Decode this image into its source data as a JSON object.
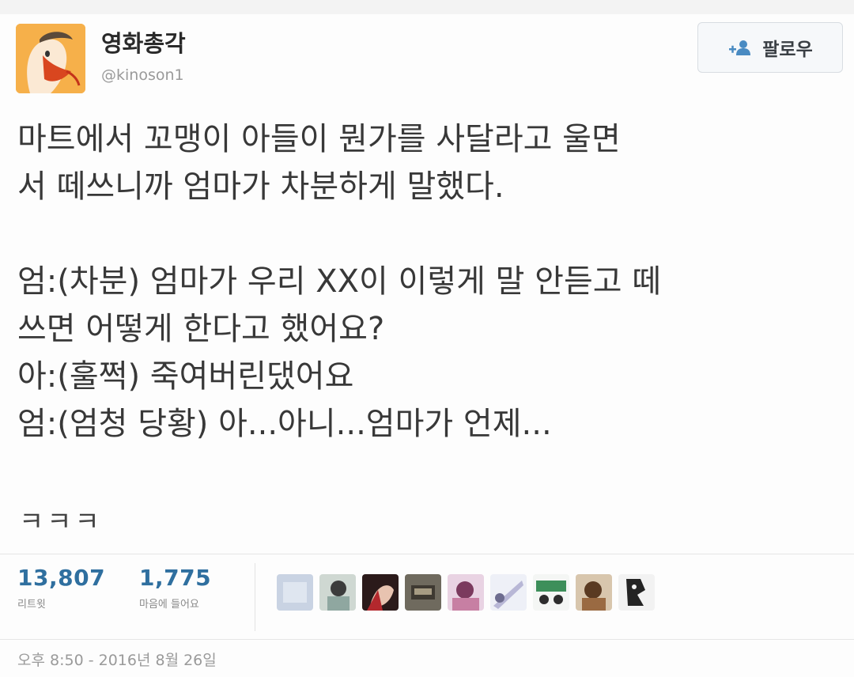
{
  "account": {
    "display_name": "영화총각",
    "handle": "@kinoson1",
    "avatar_icon": "cartoon-character-avatar"
  },
  "follow_button": {
    "label": "팔로우",
    "icon": "add-user-icon"
  },
  "tweet": {
    "lines": [
      "마트에서 꼬맹이 아들이 뭔가를 사달라고 울면",
      "서 떼쓰니까 엄마가 차분하게 말했다.",
      "",
      "엄:(차분) 엄마가 우리 XX이 이렇게 말 안듣고 떼",
      "쓰면 어떻게 한다고 했어요?",
      "아:(훌쩍) 죽여버린댔어요",
      "엄:(엄청 당황) 아...아니...엄마가 언제..."
    ],
    "reaction": "ㅋㅋㅋ"
  },
  "stats": {
    "retweets": {
      "value": "13,807",
      "label": "리트윗"
    },
    "likes": {
      "value": "1,775",
      "label": "마음에 들어요"
    }
  },
  "likers": [
    {
      "icon": "liker-avatar-1"
    },
    {
      "icon": "liker-avatar-2"
    },
    {
      "icon": "liker-avatar-3"
    },
    {
      "icon": "liker-avatar-4"
    },
    {
      "icon": "liker-avatar-5"
    },
    {
      "icon": "liker-avatar-6"
    },
    {
      "icon": "liker-avatar-7"
    },
    {
      "icon": "liker-avatar-8"
    },
    {
      "icon": "liker-avatar-9"
    }
  ],
  "timestamp": "오후 8:50 - 2016년 8월 26일",
  "colors": {
    "stat_value": "#2f6f9f",
    "text": "#383838",
    "muted": "#9a9a9a"
  }
}
